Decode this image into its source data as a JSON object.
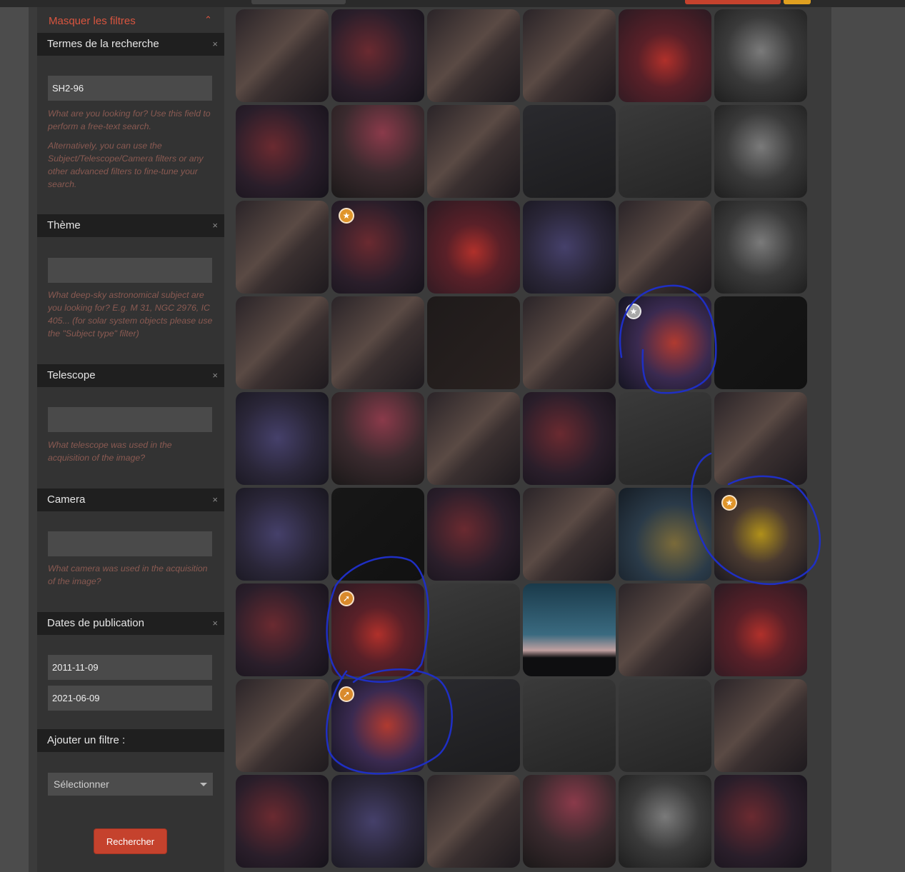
{
  "colors": {
    "accent": "#d9553f",
    "button": "#c5422d",
    "help_text": "#8a5a52",
    "annotation": "#1f2fc4"
  },
  "filters": {
    "toggle_label": "Masquer les filtres",
    "toggle_icon": "chevron-up-icon",
    "search_terms": {
      "header": "Termes de la recherche",
      "value": "SH2-96",
      "help1": "What are you looking for? Use this field to perform a free-text search.",
      "help2": "Alternatively, you can use the Subject/Telescope/Camera filters or any other advanced filters to fine-tune your search."
    },
    "subject": {
      "header": "Thème",
      "value": "",
      "help": "What deep-sky astronomical subject are you looking for? E.g. M 31, NGC 2976, IC 405... (for solar system objects please use the \"Subject type\" filter)"
    },
    "telescope": {
      "header": "Telescope",
      "value": "",
      "help": "What telescope was used in the acquisition of the image?"
    },
    "camera": {
      "header": "Camera",
      "value": "",
      "help": "What camera was used in the acquisition of the image?"
    },
    "dates": {
      "header": "Dates de publication",
      "from": "2011-11-09",
      "to": "2021-06-09"
    },
    "add_filter": {
      "header": "Ajouter un filtre :",
      "selected": "Sélectionner"
    },
    "search_button": "Rechercher",
    "remove_glyph": "×"
  },
  "results": {
    "thumbnails": [
      {
        "style": "milky",
        "award": null
      },
      {
        "style": "veil",
        "award": null
      },
      {
        "style": "milky",
        "award": null
      },
      {
        "style": "milky",
        "award": null
      },
      {
        "style": "red",
        "award": null
      },
      {
        "style": "mono",
        "award": null
      },
      {
        "style": "veil",
        "award": null
      },
      {
        "style": "pink",
        "award": null
      },
      {
        "style": "milky",
        "award": null
      },
      {
        "style": "dark",
        "award": null
      },
      {
        "style": "grey",
        "award": null
      },
      {
        "style": "mono",
        "award": null
      },
      {
        "style": "milky",
        "award": null
      },
      {
        "style": "veil",
        "award": "gold"
      },
      {
        "style": "red",
        "award": null
      },
      {
        "style": "blue",
        "award": null
      },
      {
        "style": "milky",
        "award": null
      },
      {
        "style": "mono",
        "award": null
      },
      {
        "style": "milky",
        "award": null
      },
      {
        "style": "milky",
        "award": null
      },
      {
        "style": "meteor",
        "award": null
      },
      {
        "style": "milky",
        "award": null
      },
      {
        "style": "redblue",
        "award": "silver"
      },
      {
        "style": "black",
        "award": null
      },
      {
        "style": "blue",
        "award": null
      },
      {
        "style": "pink",
        "award": null
      },
      {
        "style": "milky",
        "award": null
      },
      {
        "style": "veil",
        "award": null
      },
      {
        "style": "grey",
        "award": null
      },
      {
        "style": "milky",
        "award": null
      },
      {
        "style": "blue",
        "award": null
      },
      {
        "style": "black",
        "award": null
      },
      {
        "style": "veil",
        "award": null
      },
      {
        "style": "milky",
        "award": null
      },
      {
        "style": "teal",
        "award": null
      },
      {
        "style": "yellow",
        "award": "gold"
      },
      {
        "style": "veil",
        "award": null
      },
      {
        "style": "red",
        "award": "orange"
      },
      {
        "style": "grey",
        "award": null
      },
      {
        "style": "sky",
        "award": null
      },
      {
        "style": "milky",
        "award": null
      },
      {
        "style": "red",
        "award": null
      },
      {
        "style": "milky",
        "award": null
      },
      {
        "style": "redblue",
        "award": "orange"
      },
      {
        "style": "dark",
        "award": null
      },
      {
        "style": "grey",
        "award": null
      },
      {
        "style": "grey",
        "award": null
      },
      {
        "style": "milky",
        "award": null
      },
      {
        "style": "veil",
        "award": null
      },
      {
        "style": "blue",
        "award": null
      },
      {
        "style": "milky",
        "award": null
      },
      {
        "style": "pink",
        "award": null
      },
      {
        "style": "mono",
        "award": null
      },
      {
        "style": "veil",
        "award": null
      }
    ]
  }
}
